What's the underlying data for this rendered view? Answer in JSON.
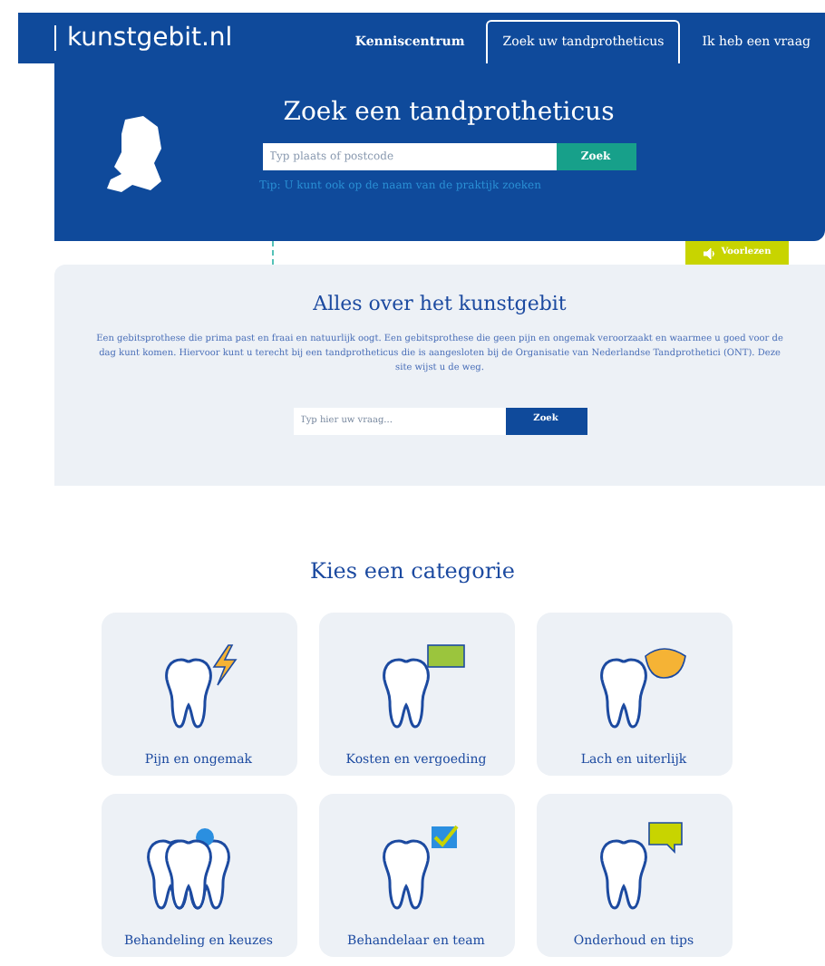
{
  "header": {
    "logo": "kunstgebit.nl",
    "tabs": [
      {
        "label": "Kenniscentrum",
        "selected": false
      },
      {
        "label": "Zoek uw tandprotheticus",
        "selected": true
      },
      {
        "label": "Ik heb een vraag",
        "selected": false
      }
    ]
  },
  "hero": {
    "title": "Zoek een tandprotheticus",
    "search": {
      "placeholder": "Typ plaats of postcode",
      "button": "Zoek"
    },
    "tip": "Tip: U kunt ook op de naam van de praktijk zoeken"
  },
  "read_aloud": "Voorlezen",
  "intro": {
    "title": "Alles over het kunstgebit",
    "text": "Een gebitsprothese die prima past en fraai en natuurlijk oogt. Een gebitsprothese die geen pijn en ongemak veroorzaakt en waarmee u goed voor de dag kunt komen. Hiervoor kunt u terecht bij een tandprotheticus die is aangesloten bij de Organisatie van Nederlandse Tandprothetici (ONT). Deze site wijst u de weg.",
    "search": {
      "placeholder": "Typ hier uw vraag...",
      "button": "Zoek"
    }
  },
  "categories": {
    "title": "Kies een categorie",
    "items": [
      {
        "label": "Pijn en ongemak",
        "kind": "pain"
      },
      {
        "label": "Kosten en vergoeding",
        "kind": "cost"
      },
      {
        "label": "Lach en uiterlijk",
        "kind": "smile"
      },
      {
        "label": "Behandeling en keuzes",
        "kind": "treatment"
      },
      {
        "label": "Behandelaar en team",
        "kind": "team"
      },
      {
        "label": "Onderhoud en tips",
        "kind": "tips"
      }
    ]
  }
}
